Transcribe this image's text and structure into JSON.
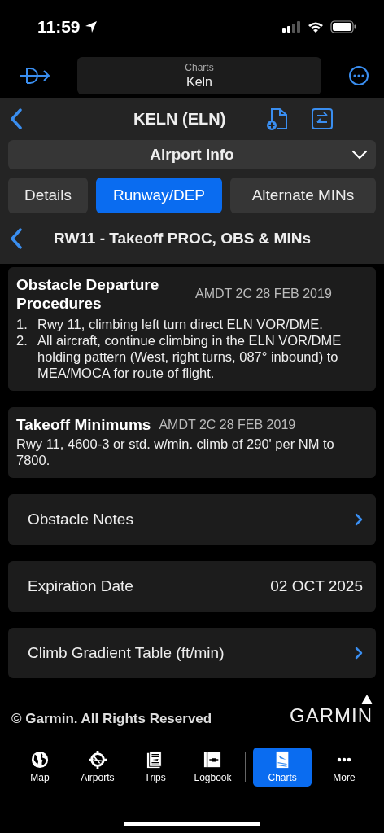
{
  "status_bar": {
    "time": "11:59"
  },
  "top_bar": {
    "label": "Charts",
    "value": "Keln"
  },
  "header": {
    "title": "KELN (ELN)"
  },
  "dropdown": {
    "label": "Airport Info"
  },
  "tabs": [
    {
      "label": "Details",
      "selected": false
    },
    {
      "label": "Runway/DEP",
      "selected": true
    },
    {
      "label": "Alternate MINs",
      "selected": false
    }
  ],
  "section": {
    "title": "RW11 - Takeoff PROC, OBS & MINs"
  },
  "cards": [
    {
      "title": "Obstacle Departure Procedures",
      "amendment": "AMDT 2C 28 FEB 2019",
      "items": [
        {
          "number": "1.",
          "text": "Rwy 11, climbing left turn direct ELN VOR/DME."
        },
        {
          "number": "2.",
          "text": "All aircraft, continue climbing in the ELN VOR/DME holding pattern (West, right turns, 087° inbound) to MEA/MOCA for route of flight."
        }
      ]
    },
    {
      "title": "Takeoff Minimums",
      "amendment": "AMDT 2C 28 FEB 2019",
      "body": "Rwy 11, 4600-3 or std. w/min. climb of 290' per NM to 7800."
    }
  ],
  "rows": [
    {
      "kind": "link",
      "label": "Obstacle Notes"
    },
    {
      "kind": "value",
      "label": "Expiration Date",
      "value": "02 OCT 2025"
    },
    {
      "kind": "link",
      "label": "Climb Gradient Table (ft/min)"
    }
  ],
  "footer": {
    "copyright": "© Garmin. All Rights Reserved",
    "logo": "GARMIN"
  },
  "tab_bar": [
    {
      "kind": "globe",
      "label": "Map",
      "selected": false
    },
    {
      "kind": "airport",
      "label": "Airports",
      "selected": false
    },
    {
      "kind": "trips",
      "label": "Trips",
      "selected": false
    },
    {
      "kind": "logbook",
      "label": "Logbook",
      "selected": false
    },
    {
      "kind": "charts",
      "label": "Charts",
      "selected": true
    },
    {
      "kind": "more",
      "label": "More",
      "selected": false
    }
  ]
}
